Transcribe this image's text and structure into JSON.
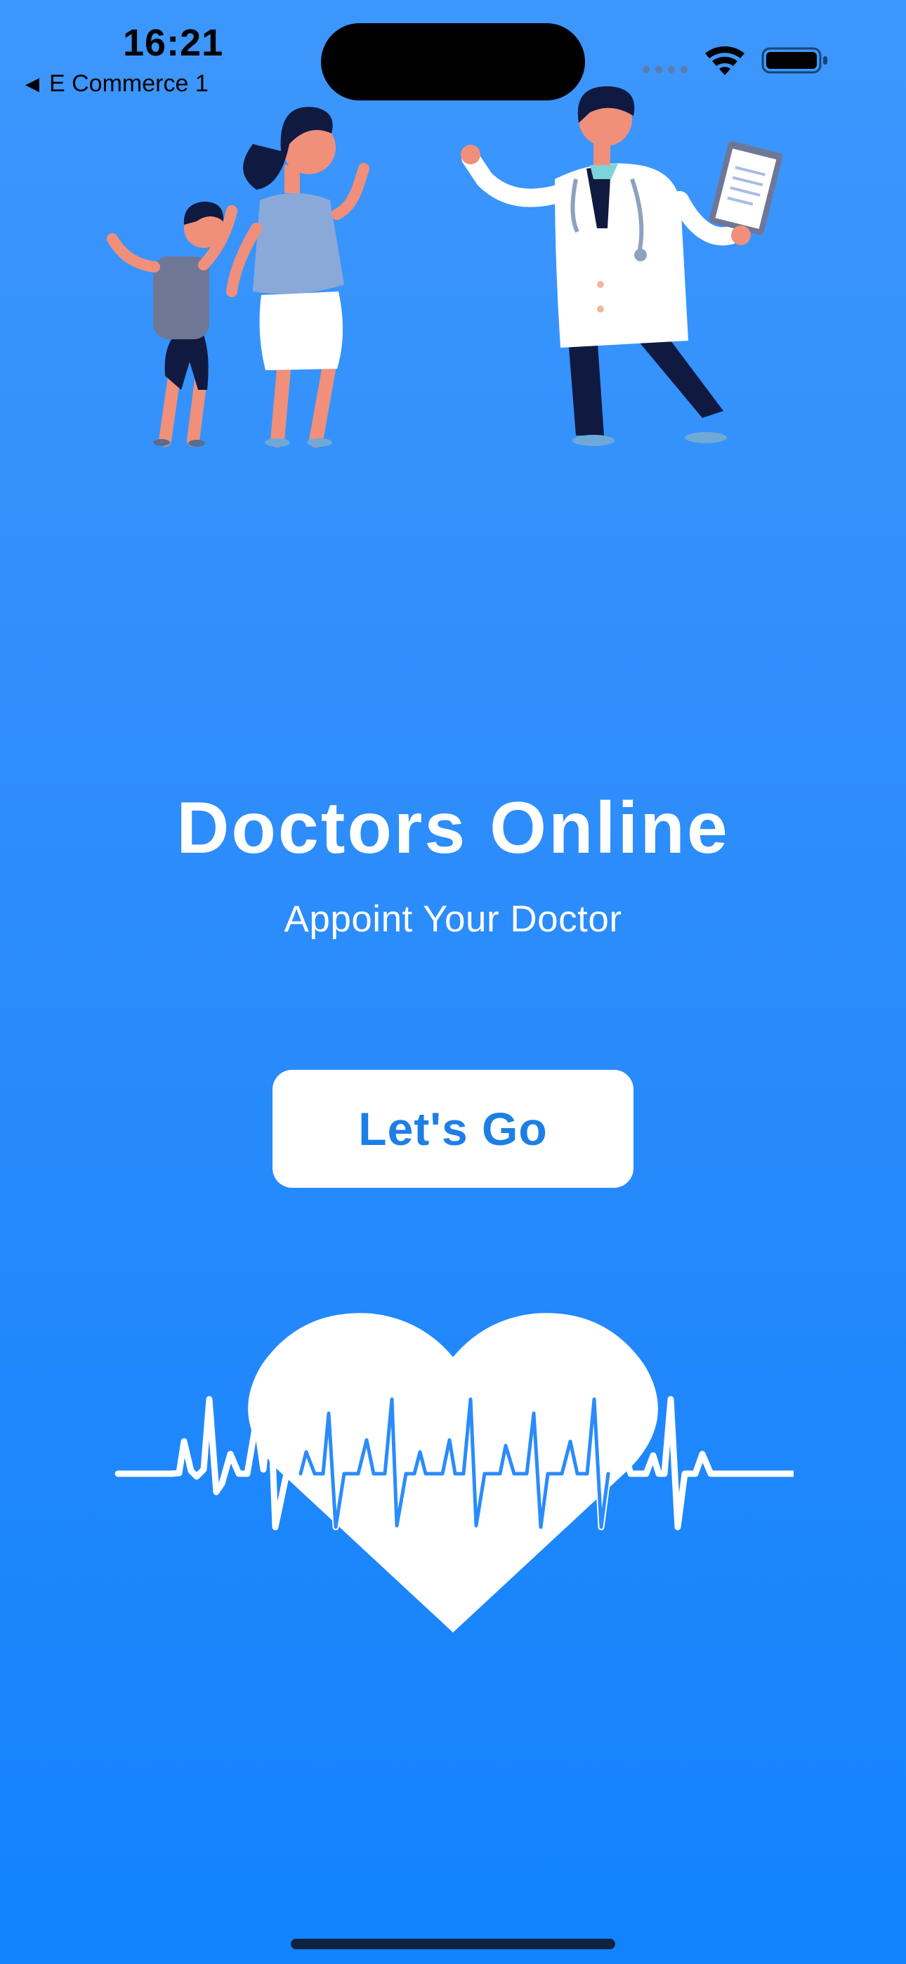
{
  "status_bar": {
    "time": "16:21",
    "back_label": "E Commerce 1",
    "icons": [
      "cellular-icon",
      "wifi-icon",
      "battery-icon"
    ]
  },
  "hero": {
    "illustration": "doctor-greeting-family-illustration"
  },
  "title": "Doctors Online",
  "subtitle": "Appoint Your Doctor",
  "cta": {
    "label": "Let's Go"
  },
  "decoration": "heart-heartbeat-icon",
  "colors": {
    "background_top": "#3d97fc",
    "background_bottom": "#1283fd",
    "button_text": "#1d7fe6",
    "button_bg": "#ffffff"
  }
}
